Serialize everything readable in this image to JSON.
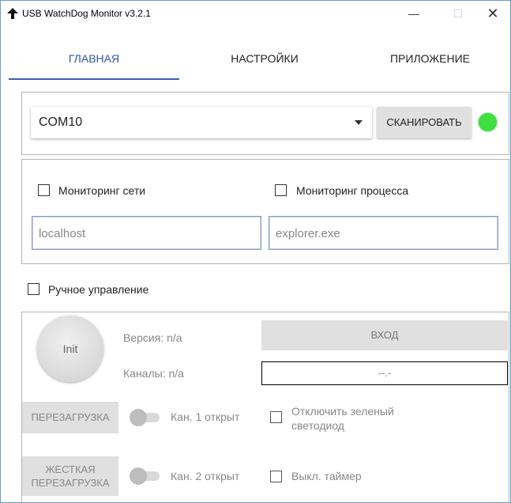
{
  "window": {
    "title": "USB WatchDog Monitor v3.2.1",
    "minimize": "—",
    "maximize": "☐",
    "close": "✕"
  },
  "tabs": [
    {
      "label": "ГЛАВНАЯ",
      "active": true
    },
    {
      "label": "НАСТРОЙКИ",
      "active": false
    },
    {
      "label": "ПРИЛОЖЕНИЕ",
      "active": false
    }
  ],
  "port": {
    "selected": "COM10",
    "scan_label": "СКАНИРОВАТЬ",
    "led_color": "#3de03d"
  },
  "monitoring": {
    "network_label": "Мониторинг сети",
    "process_label": "Мониторинг процесса",
    "network_placeholder": "localhost",
    "process_placeholder": "explorer.exe"
  },
  "manual": {
    "label": "Ручное управление",
    "init_label": "Init",
    "version": "Версия: n/a",
    "channels": "Каналы: n/a",
    "entry_label": "ВХОД",
    "code_value": "--.-",
    "reboot_label": "ПЕРЕЗАГРУЗКА",
    "hard_reboot_line1": "ЖЕСТКАЯ",
    "hard_reboot_line2": "ПЕРЕЗАГРУЗКА",
    "ch1_label": "Кан. 1 открыт",
    "ch2_label": "Кан. 2 открыт",
    "green_led_line1": "Отключить зеленый",
    "green_led_line2": "светодиод",
    "timer_label": "Выкл. таймер"
  }
}
